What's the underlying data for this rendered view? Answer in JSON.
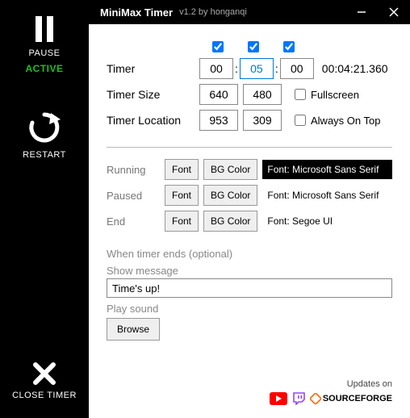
{
  "title": "MiniMax Timer",
  "version": "v1.2 by honganqi",
  "sidebar": {
    "pause": "PAUSE",
    "active": "ACTIVE",
    "restart": "RESTART",
    "close": "CLOSE TIMER"
  },
  "checks": {
    "h": true,
    "m": true,
    "s": true
  },
  "timer": {
    "label": "Timer",
    "h": "00",
    "m": "05",
    "s": "00",
    "elapsed": "00:04:21.360"
  },
  "size": {
    "label": "Timer Size",
    "w": "640",
    "h": "480",
    "fullscreen_label": "Fullscreen",
    "fullscreen": false
  },
  "location": {
    "label": "Timer Location",
    "x": "953",
    "y": "309",
    "ontop_label": "Always On Top",
    "ontop": false
  },
  "states": {
    "font_btn": "Font",
    "bg_btn": "BG Color",
    "running": {
      "label": "Running",
      "font": "Font: Microsoft Sans Serif"
    },
    "paused": {
      "label": "Paused",
      "font": "Font: Microsoft Sans Serif"
    },
    "end": {
      "label": "End",
      "font": "Font: Segoe UI"
    }
  },
  "end_section": {
    "header": "When timer ends (optional)",
    "show_msg_label": "Show message",
    "msg_value": "Time's up!",
    "play_sound_label": "Play sound",
    "browse": "Browse"
  },
  "footer": {
    "updates": "Updates on",
    "sourceforge": "SOURCEFORGE"
  }
}
